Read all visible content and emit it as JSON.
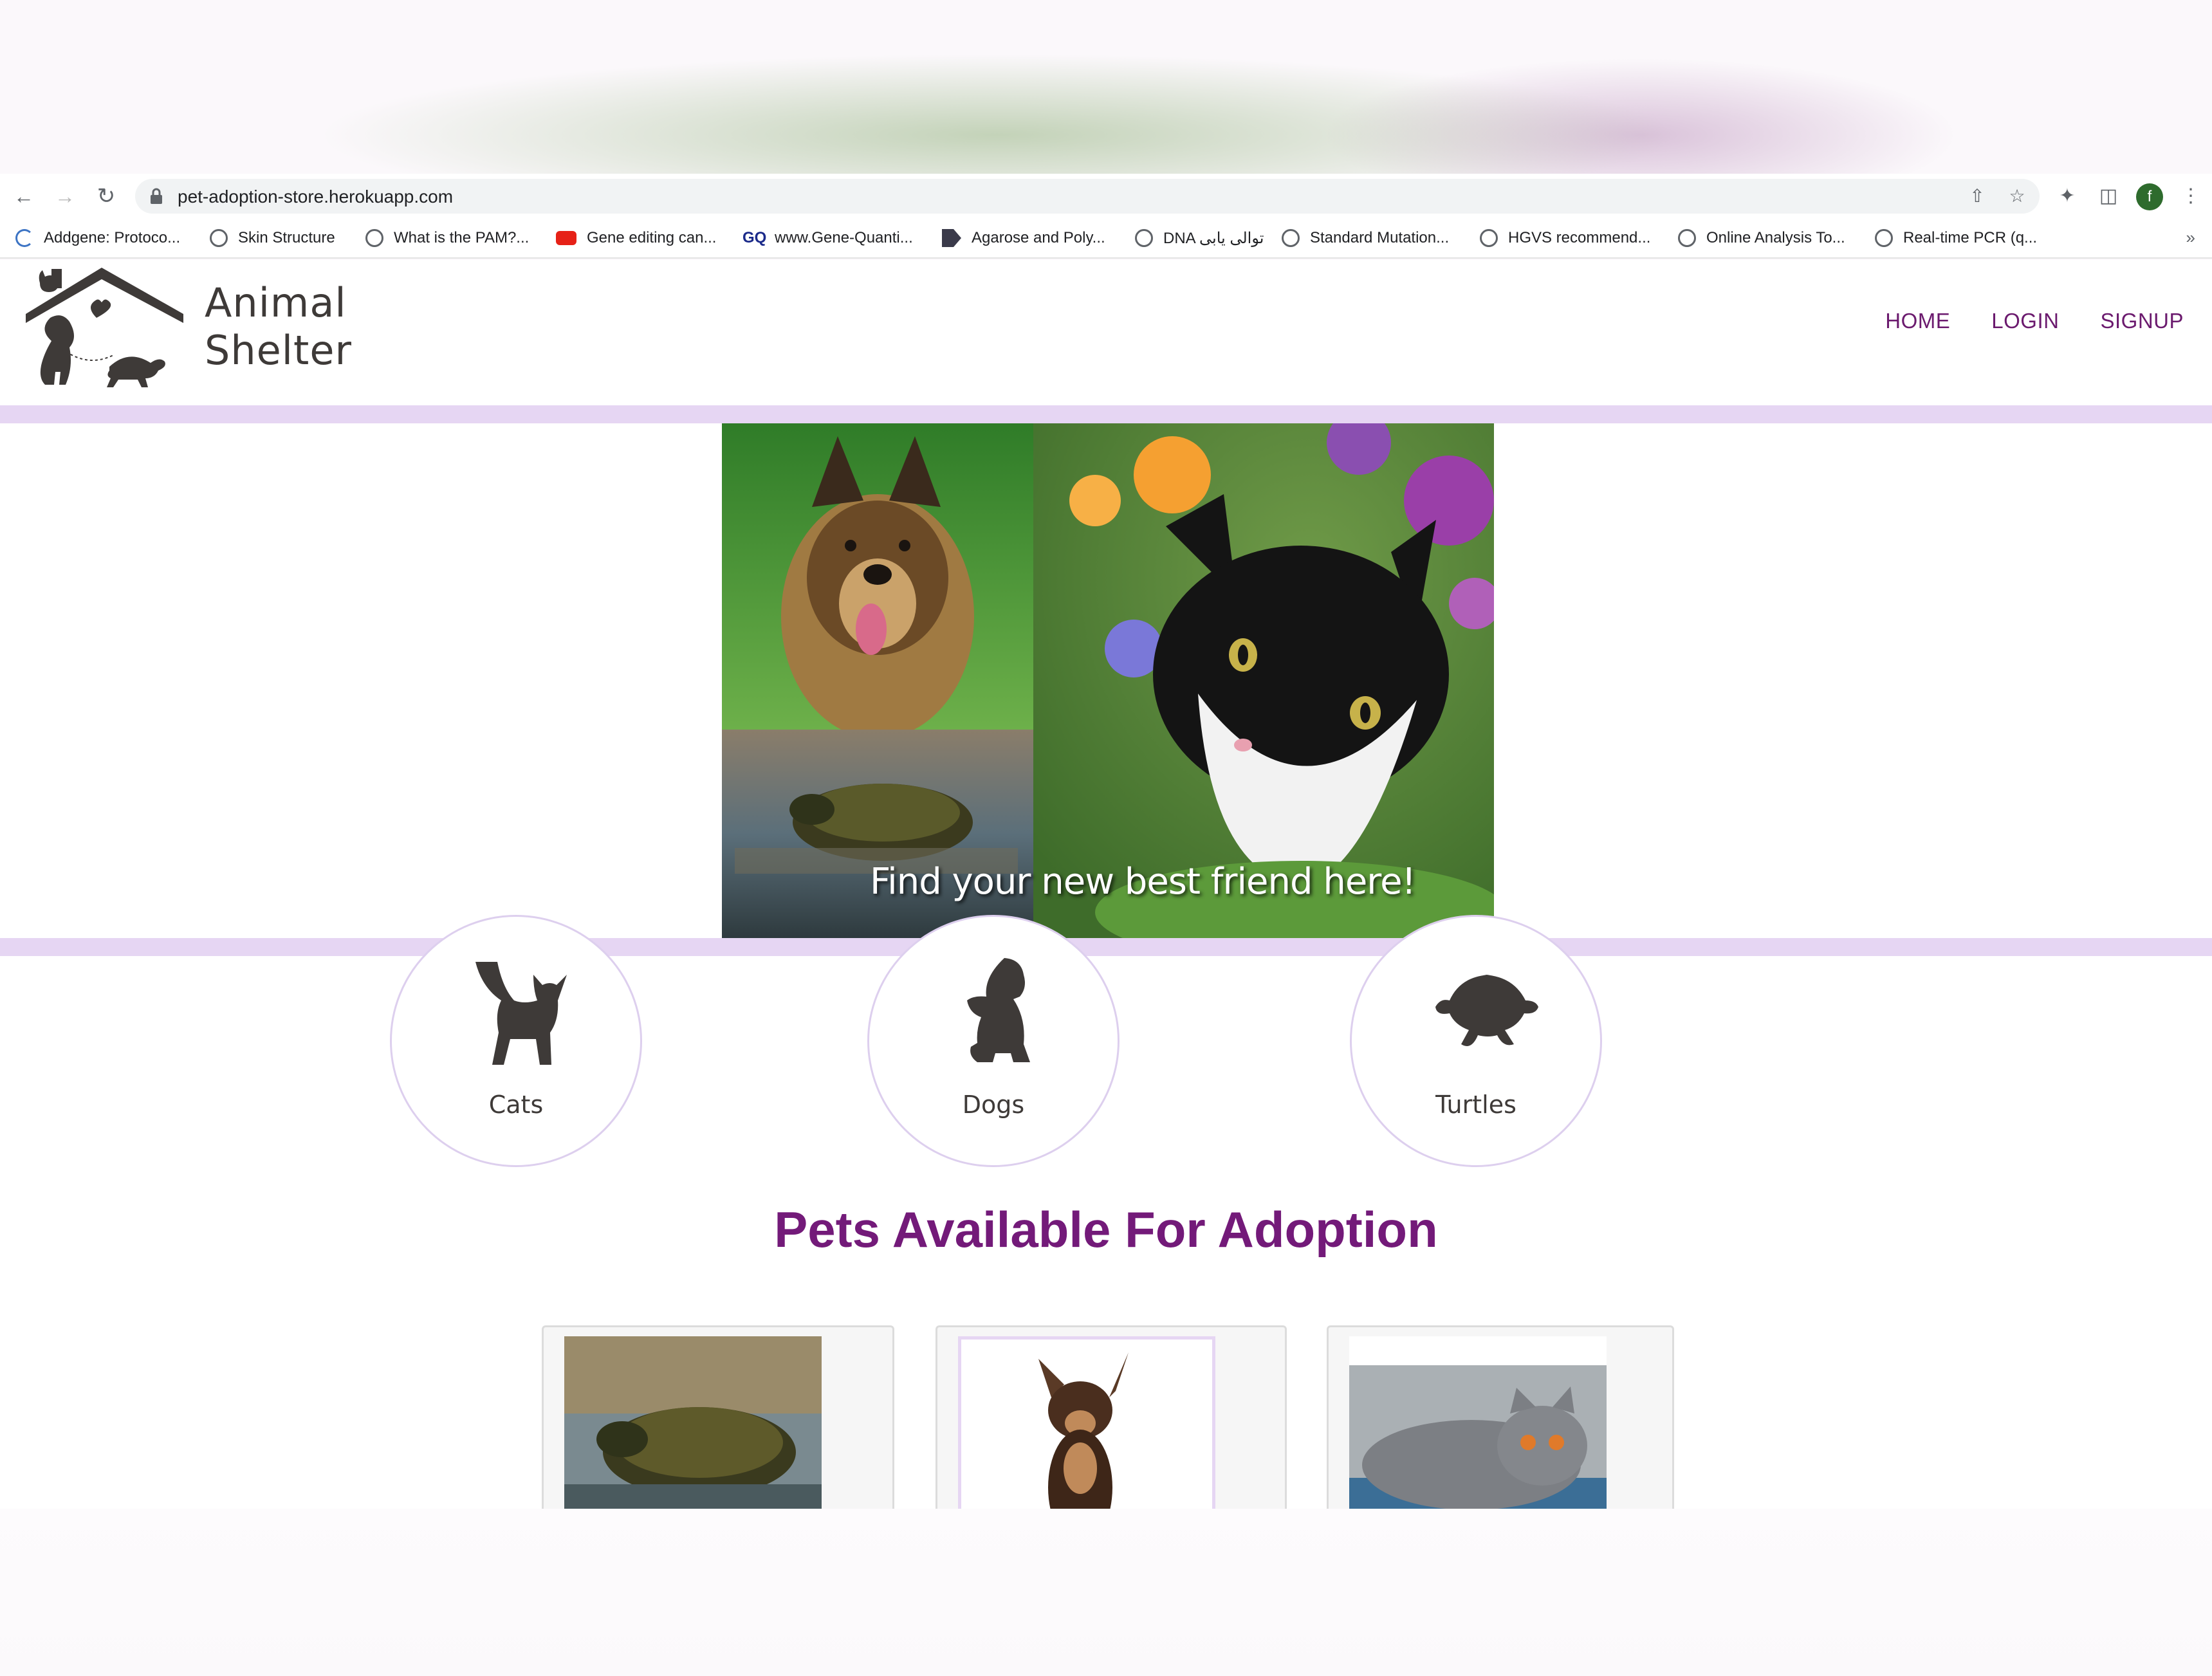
{
  "browser": {
    "url": "pet-adoption-store.herokuapp.com",
    "avatar_letter": "f",
    "bookmarks": [
      {
        "label": "Addgene: Protoco...",
        "icon": "addgene-icon"
      },
      {
        "label": "Skin Structure",
        "icon": "globe-icon"
      },
      {
        "label": "What is the PAM?...",
        "icon": "globe-icon"
      },
      {
        "label": "Gene editing can...",
        "icon": "youtube-icon"
      },
      {
        "label": "www.Gene-Quanti...",
        "icon": "gq-icon"
      },
      {
        "label": "Agarose and Poly...",
        "icon": "agarose-icon"
      },
      {
        "label": "DNA توالی یابی",
        "icon": "globe-icon"
      },
      {
        "label": "Standard Mutation...",
        "icon": "globe-icon"
      },
      {
        "label": "HGVS recommend...",
        "icon": "globe-icon"
      },
      {
        "label": "Online Analysis To...",
        "icon": "globe-icon"
      },
      {
        "label": "Real-time PCR (q...",
        "icon": "globe-icon"
      }
    ],
    "more_label": "»"
  },
  "header": {
    "logo_line1": "Animal",
    "logo_line2": "Shelter",
    "nav": [
      "HOME",
      "LOGIN",
      "SIGNUP"
    ]
  },
  "hero": {
    "caption": "Find your new best friend here!"
  },
  "categories": [
    {
      "label": "Cats",
      "icon": "cat-silhouette-icon"
    },
    {
      "label": "Dogs",
      "icon": "dog-silhouette-icon"
    },
    {
      "label": "Turtles",
      "icon": "turtle-silhouette-icon"
    }
  ],
  "adoption": {
    "title": "Pets Available For Adoption",
    "cards": [
      {
        "animal": "turtle"
      },
      {
        "animal": "dog"
      },
      {
        "animal": "cat"
      }
    ]
  },
  "colors": {
    "accent_purple": "#731a79",
    "stripe_lavender": "#e6d6f3",
    "logo_dark": "#3e3a38"
  }
}
